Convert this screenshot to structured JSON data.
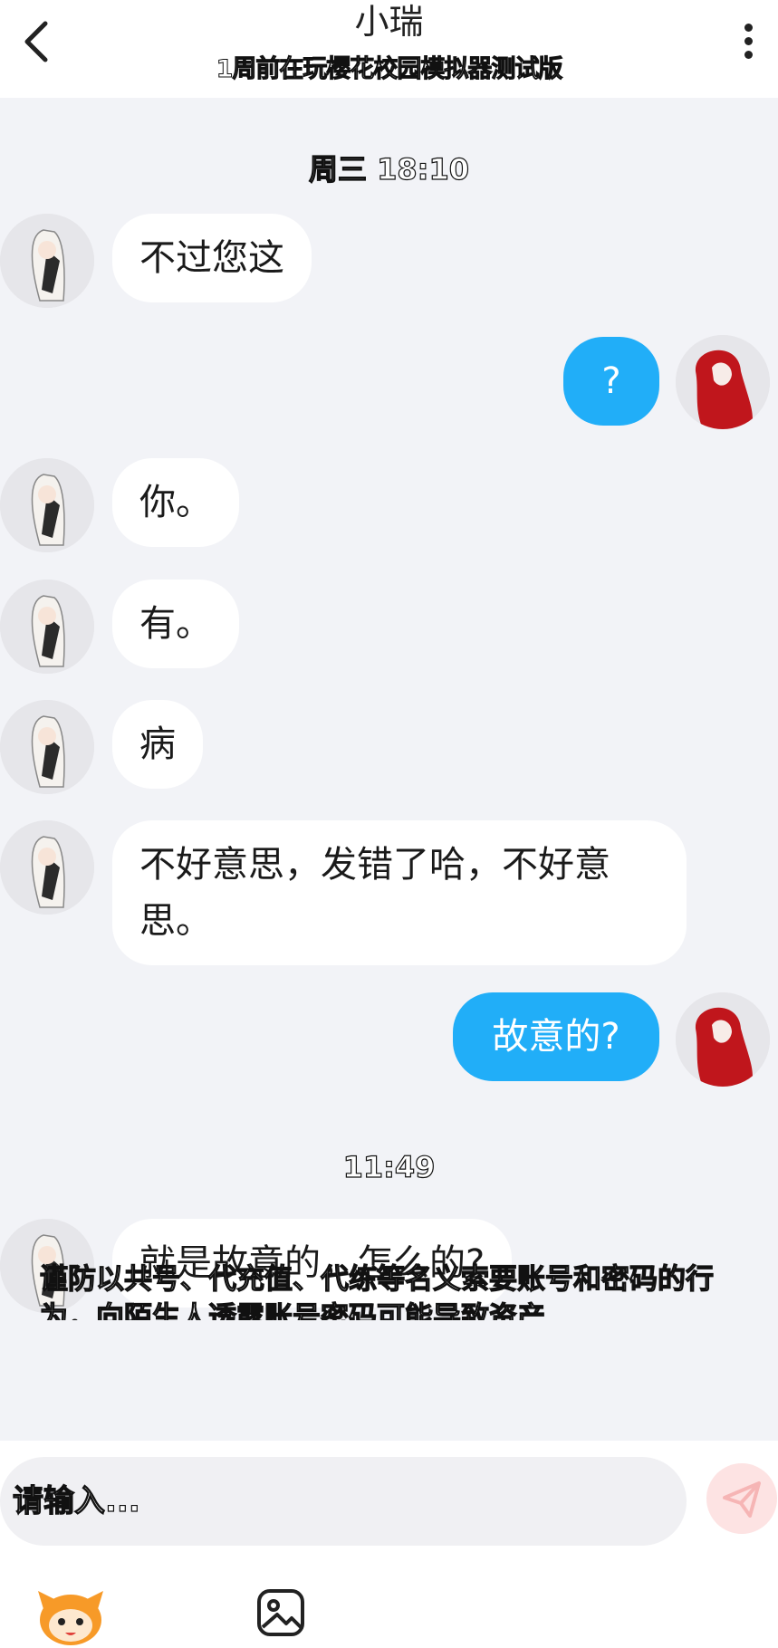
{
  "header": {
    "title": "小瑞",
    "subtitle": "1周前在玩樱花校园模拟器测试版"
  },
  "messages": [
    {
      "type": "time",
      "text": "周三 18:10"
    },
    {
      "type": "msg",
      "side": "left",
      "text": "不过您这"
    },
    {
      "type": "msg",
      "side": "right",
      "text": "?"
    },
    {
      "type": "msg",
      "side": "left",
      "text": "你。"
    },
    {
      "type": "msg",
      "side": "left",
      "text": "有。"
    },
    {
      "type": "msg",
      "side": "left",
      "text": "病"
    },
    {
      "type": "msg",
      "side": "left",
      "text": "不好意思，发错了哈，不好意思。"
    },
    {
      "type": "msg",
      "side": "right",
      "text": "故意的?"
    },
    {
      "type": "time",
      "text": "11:49"
    },
    {
      "type": "msg",
      "side": "left",
      "text": "就是故意的，怎么的?"
    }
  ],
  "notice": "谨防以共号、代充值、代练等名义索要账号和密码的行为，向陌生人透露账号密码可能导致资产",
  "input": {
    "placeholder": "请输入..."
  },
  "colors": {
    "my_bubble": "#21aef8",
    "their_bubble": "#ffffff",
    "background": "#f2f3f7"
  }
}
